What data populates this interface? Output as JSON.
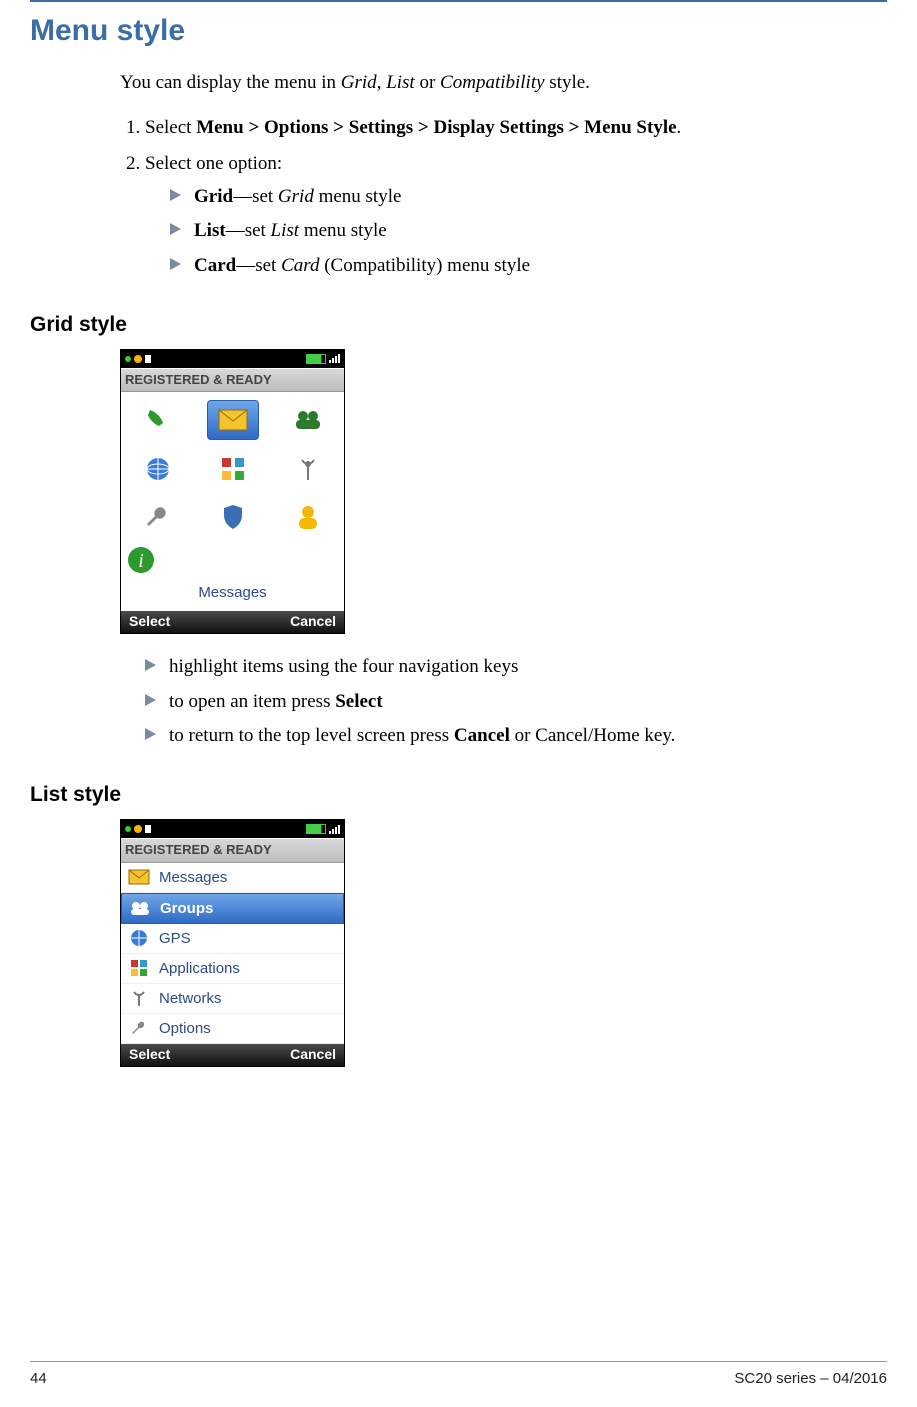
{
  "title": "Menu style",
  "intro": {
    "pre": "You can display the menu in ",
    "opt1": "Grid",
    "sep1": ", ",
    "opt2": "List",
    "sep2": " or ",
    "opt3": "Compatibility",
    "post": " style."
  },
  "steps": {
    "s1_pre": "Select ",
    "s1_nav": "Menu > Options > Settings > Display Settings > Menu Style",
    "s1_post": ".",
    "s2": "Select one option:",
    "opt_grid_b": "Grid",
    "opt_grid_mid": "—set ",
    "opt_grid_i": "Grid",
    "opt_grid_post": " menu style",
    "opt_list_b": "List",
    "opt_list_mid": "—set ",
    "opt_list_i": "List",
    "opt_list_post": " menu style",
    "opt_card_b": "Card",
    "opt_card_mid": "—set ",
    "opt_card_i": "Card",
    "opt_card_par": " (Compatibility) menu style"
  },
  "grid_heading": "Grid style",
  "grid_notes": {
    "n1": "highlight items using the four navigation keys",
    "n2_pre": "to open an item press ",
    "n2_b": "Select",
    "n3_pre": "to return to the top level screen press ",
    "n3_b": "Cancel",
    "n3_post": " or Cancel/Home key."
  },
  "list_heading": "List style",
  "phone": {
    "banner": "REGISTERED & READY",
    "soft_left": "Select",
    "soft_right": "Cancel",
    "grid_caption": "Messages",
    "list_items": [
      "Messages",
      "Groups",
      "GPS",
      "Applications",
      "Networks",
      "Options"
    ],
    "list_selected_index": 1
  },
  "footer": {
    "page": "44",
    "doc": "SC20 series – 04/2016"
  }
}
